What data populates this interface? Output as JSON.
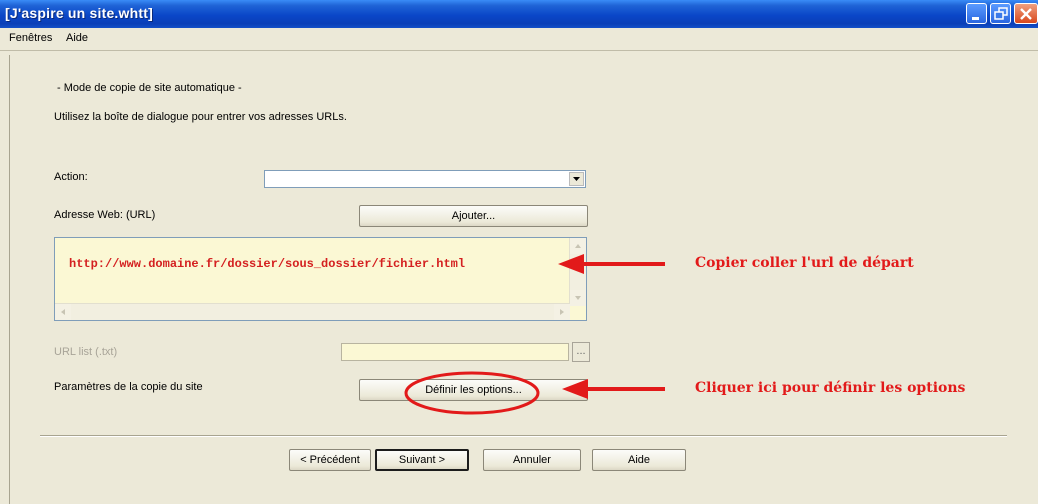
{
  "window": {
    "title": "[J'aspire un site.whtt]"
  },
  "menu": {
    "items": [
      "Fenêtres",
      "Aide"
    ]
  },
  "page": {
    "mode_label": "- Mode de copie de site automatique -",
    "instructions": "Utilisez la boîte de dialogue pour entrer vos adresses URLs.",
    "action_label": "Action:",
    "action_value": "",
    "url_label": "Adresse Web: (URL)",
    "add_button": "Ajouter...",
    "url_value": "http://www.domaine.fr/dossier/sous_dossier/fichier.html",
    "url_list_label": "URL list (.txt)",
    "url_list_value": "",
    "browse_button": "...",
    "params_label": "Paramètres de la copie du site",
    "options_button": "Définir les options..."
  },
  "footer": {
    "prev_button": "< Précédent",
    "next_button": "Suivant >",
    "cancel_button": "Annuler",
    "help_button": "Aide"
  },
  "annotations": {
    "copy_paste": "Copier coller l'url de départ",
    "click_options": "Cliquer ici pour définir les options",
    "color": "#e21a1a"
  },
  "colors": {
    "titlebar": "#0a46c8",
    "window_bg": "#ece9d8",
    "url_field_bg": "#fbf8d4",
    "url_text": "#d42020"
  }
}
